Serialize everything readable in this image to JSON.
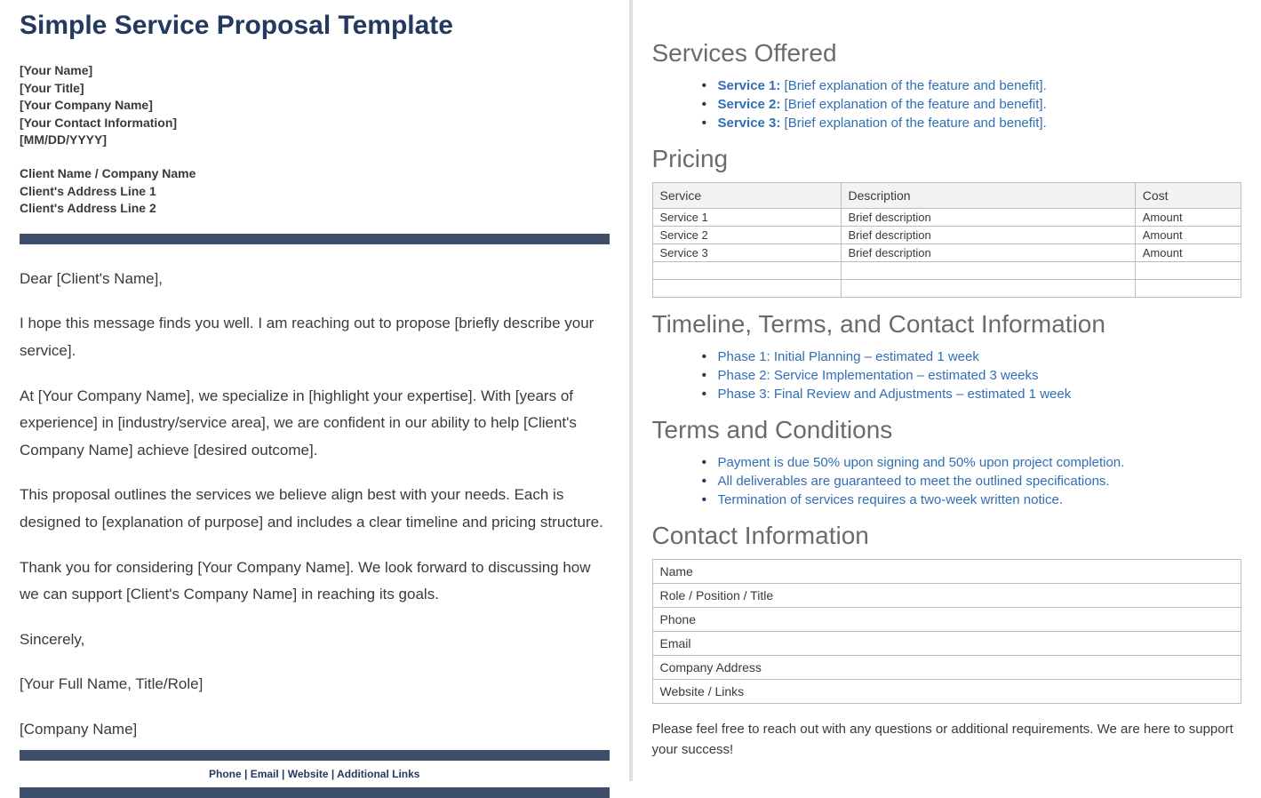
{
  "title": "Simple Service Proposal Template",
  "sender": {
    "name": "[Your Name]",
    "title": "[Your Title]",
    "company": "[Your Company Name]",
    "contact": "[Your Contact Information]",
    "date": "[MM/DD/YYYY]"
  },
  "client": {
    "name_company": "Client Name / Company Name",
    "addr1": "Client's Address Line 1",
    "addr2": "Client's Address Line 2"
  },
  "letter": {
    "salutation": "Dear [Client's Name],",
    "p1": "I hope this message finds you well. I am reaching out to propose [briefly describe your service].",
    "p2": "At [Your Company Name], we specialize in [highlight your expertise]. With [years of experience] in [industry/service area], we are confident in our ability to help [Client's Company Name] achieve [desired outcome].",
    "p3": "This proposal outlines the services we believe align best with your needs. Each is designed to [explanation of purpose] and includes a clear timeline and pricing structure.",
    "p4": "Thank you for considering [Your Company Name]. We look forward to discussing how we can support [Client's Company Name] in reaching its goals.",
    "closing": "Sincerely,",
    "sig_name": "[Your Full Name, Title/Role]",
    "sig_company": "[Company Name]"
  },
  "footer": "Phone | Email | Website | Additional Links",
  "services_heading": "Services Offered",
  "services": [
    {
      "label": "Service 1:",
      "desc": " [Brief explanation of the feature and benefit]."
    },
    {
      "label": "Service 2:",
      "desc": " [Brief explanation of the feature and benefit]."
    },
    {
      "label": "Service 3:",
      "desc": " [Brief explanation of the feature and benefit]."
    }
  ],
  "pricing_heading": "Pricing",
  "pricing": {
    "headers": [
      "Service",
      "Description",
      "Cost"
    ],
    "rows": [
      [
        "Service 1",
        "Brief description",
        "Amount"
      ],
      [
        "Service 2",
        "Brief description",
        "Amount"
      ],
      [
        "Service 3",
        "Brief description",
        "Amount"
      ],
      [
        "",
        "",
        ""
      ],
      [
        "",
        "",
        ""
      ]
    ]
  },
  "timeline_heading": "Timeline, Terms, and Contact Information",
  "timeline": [
    "Phase 1: Initial Planning – estimated 1 week",
    "Phase 2: Service Implementation – estimated 3 weeks",
    "Phase 3: Final Review and Adjustments – estimated 1 week"
  ],
  "terms_heading": "Terms and Conditions",
  "terms": [
    "Payment is due 50% upon signing and 50% upon project completion.",
    "All deliverables are guaranteed to meet the outlined specifications.",
    "Termination of services requires a two-week written notice."
  ],
  "contact_heading": "Contact Information",
  "contact_rows": [
    "Name",
    "Role / Position / Title",
    "Phone",
    "Email",
    "Company Address",
    "Website / Links"
  ],
  "closing_note": "Please feel free to reach out with any questions or additional requirements. We are here to support your success!"
}
